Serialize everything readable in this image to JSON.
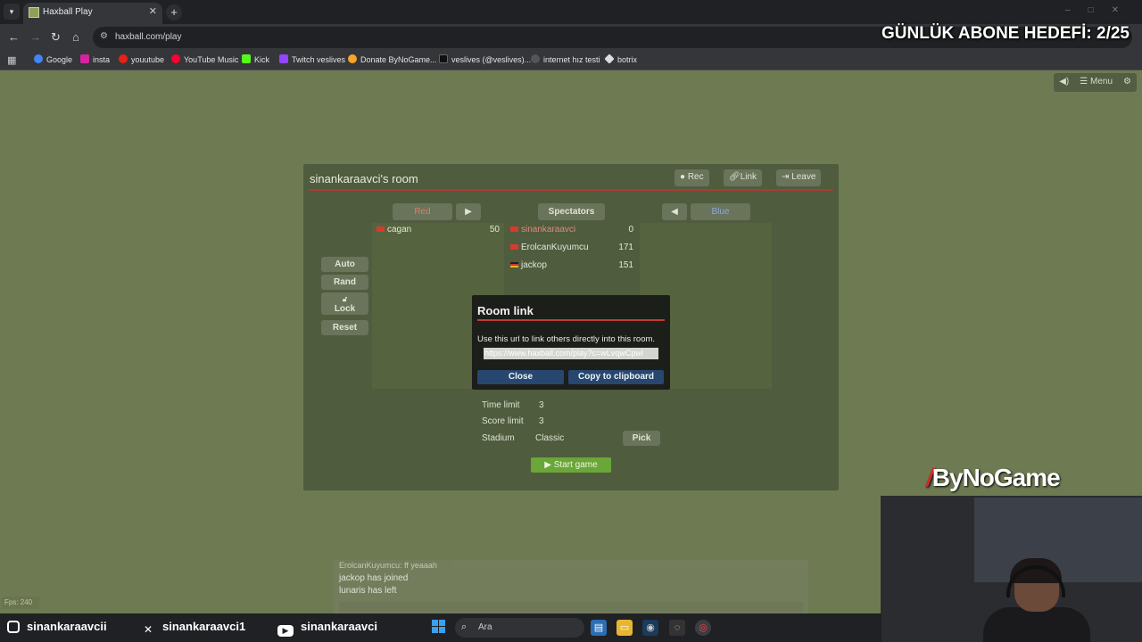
{
  "browser": {
    "tab_title": "Haxball Play",
    "url": "haxball.com/play",
    "bookmarks": [
      "Google",
      "insta",
      "youutube",
      "YouTube Music",
      "Kick",
      "Twitch veslives",
      "Donate ByNoGame...",
      "veslives (@veslives)...",
      "internet hız testi",
      "botrix"
    ]
  },
  "overlay": {
    "goal_text": "GÜNLÜK ABONE HEDEFİ: 2/25",
    "brand": "ByNoGame"
  },
  "game_top": {
    "menu_label": "Menu"
  },
  "room": {
    "title": "sinankaraavci's room",
    "buttons": {
      "rec": "Rec",
      "link": "Link",
      "leave": "Leave"
    },
    "columns": {
      "red": "Red",
      "spectators": "Spectators",
      "blue": "Blue"
    },
    "red_players": [
      {
        "name": "cagan",
        "score": "50"
      }
    ],
    "spectators": [
      {
        "name": "sinankaraavci",
        "score": "0"
      },
      {
        "name": "ErolcanKuyumcu",
        "score": "171"
      },
      {
        "name": "jackop",
        "score": "151"
      }
    ],
    "side_buttons": {
      "auto": "Auto",
      "rand": "Rand",
      "lock": "Lock",
      "reset": "Reset"
    },
    "settings": {
      "time_limit_label": "Time limit",
      "time_limit": "3",
      "score_limit_label": "Score limit",
      "score_limit": "3",
      "stadium_label": "Stadium",
      "stadium": "Classic"
    },
    "pick_label": "Pick",
    "start_label": "Start game"
  },
  "dialog": {
    "title": "Room link",
    "text": "Use this url to link others directly into this room.",
    "url": "https://www.haxball.com/play?c=wLvqwCpwl",
    "close": "Close",
    "copy": "Copy to clipboard"
  },
  "chat": {
    "lines": [
      "ErolcanKuyumcu: ff yeaaah",
      "jackop has joined",
      "lunaris has left"
    ]
  },
  "fps": "Fps: 240",
  "socials": {
    "instagram": "sinankaraavcii",
    "x": "sinankaraavci1",
    "youtube": "sinankaraavci"
  },
  "taskbar": {
    "search_placeholder": "Ara"
  },
  "colors": {
    "pitch": "#6e7a52",
    "panel": "#4f5c3e",
    "red_accent": "#b03933",
    "start_green": "#6aa638",
    "dialog_button": "#27476f"
  }
}
